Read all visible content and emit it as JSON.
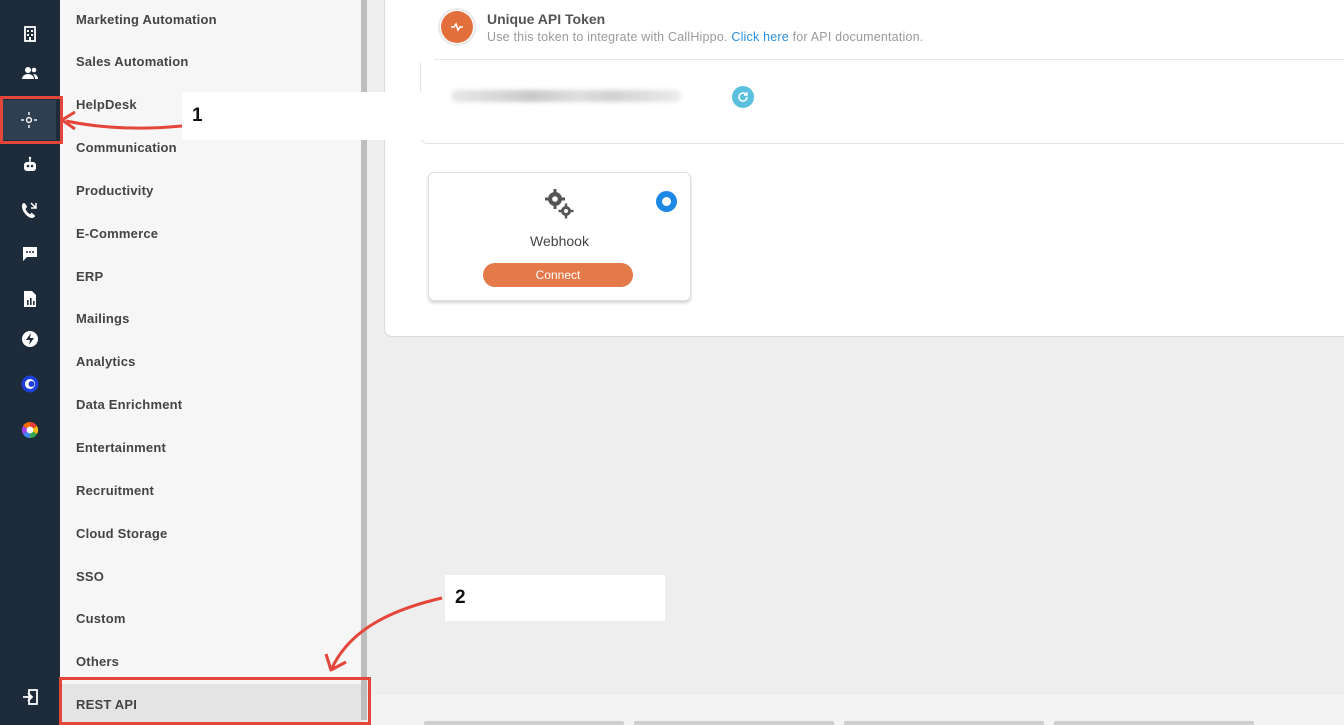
{
  "rail": {
    "icons": [
      "building-icon",
      "users-icon",
      "integrations-icon",
      "robot-icon",
      "phone-forward-icon",
      "chat-icon",
      "report-icon",
      "bolt-icon",
      "callhippo-logo-icon",
      "color-wheel-icon",
      "logout-icon"
    ],
    "active_index": 2
  },
  "categories": {
    "items": [
      "Marketing Automation",
      "Sales Automation",
      "HelpDesk",
      "Communication",
      "Productivity",
      "E-Commerce",
      "ERP",
      "Mailings",
      "Analytics",
      "Data Enrichment",
      "Entertainment",
      "Recruitment",
      "Cloud Storage",
      "SSO",
      "Custom",
      "Others",
      "REST API"
    ],
    "active": "REST API"
  },
  "api_token": {
    "title": "Unique API Token",
    "subtitle_prefix": "Use this token to integrate with CallHippo. ",
    "link_text": "Click here",
    "subtitle_suffix": " for API documentation."
  },
  "webhook": {
    "label": "Webhook",
    "connect_label": "Connect",
    "selected": true
  },
  "annotations": {
    "label_1": "1",
    "label_2": "2",
    "color": "#e5463b"
  },
  "colors": {
    "rail_bg": "#1d2b3a",
    "accent_orange": "#e4794a",
    "link_blue": "#2d8fdc",
    "radio_blue": "#1e88e5"
  }
}
